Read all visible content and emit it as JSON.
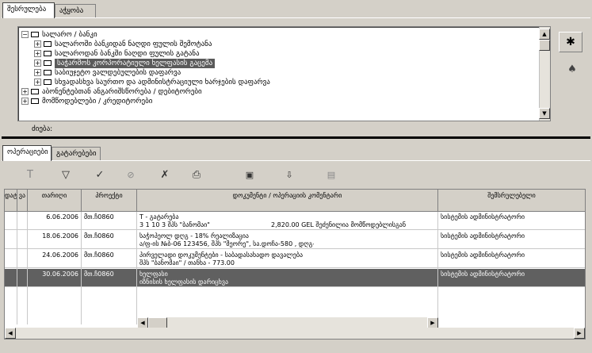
{
  "top_tabs": [
    "შესრულება",
    "აჭყობა"
  ],
  "tree": {
    "rows": [
      {
        "label": "სალარო / ბანკი",
        "level": 0,
        "expander": "−",
        "selected": false
      },
      {
        "label": "სალაროში ბანკიდან ნაღდი ფულის შემოტანა",
        "level": 1,
        "expander": "+",
        "selected": false
      },
      {
        "label": "სალაროდან ბანკში ნაღდი ფულის გატანა",
        "level": 1,
        "expander": "+",
        "selected": false
      },
      {
        "label": "საჭარმოს კორპორატიული ხელფასის გაცემა",
        "level": 1,
        "expander": "+",
        "selected": true
      },
      {
        "label": "საბიუჯეტო ვალდებულების დაფარვა",
        "level": 1,
        "expander": "+",
        "selected": false
      },
      {
        "label": "სხვადასხვა საურთო და ადმინისტრაციული ხარჯების დაფარვა",
        "level": 1,
        "expander": "+",
        "selected": false
      },
      {
        "label": "აბონენტებთან ანგარიშსწორება / დებიტორები",
        "level": 0,
        "expander": "+",
        "selected": false
      },
      {
        "label": "მომწოდებლები / კრედიტორები",
        "level": 0,
        "expander": "+",
        "selected": false
      }
    ],
    "search_label": "ძიება:"
  },
  "bottom_tabs": [
    "ოპერაციები",
    "გატარებები"
  ],
  "toolbar": {
    "icons": [
      "clear-filter-icon",
      "filter-icon",
      "approve-icon",
      "pause-icon",
      "delete-icon",
      "print-icon",
      "preview-icon",
      "export-icon",
      "copy-icon"
    ]
  },
  "grid": {
    "headers": {
      "col1": "დატა",
      "col2": "ვა",
      "date": "თარიღი",
      "project": "პროექტი",
      "desc": "დოკუმენტი / ოპერაციის კომენტარი",
      "executor": "შემსრულებელი"
    },
    "rows": [
      {
        "date": "6.06.2006",
        "project": "მთ.ჩ0860",
        "line1": "T - გატარება",
        "line2": "3 1 10 3 შპს \"ბანომაი\"",
        "amount": "2,820.00 GEL  შეძენილია მომწოდებლისგან",
        "executor": "სისტემის ადმინისტრატორი",
        "selected": false
      },
      {
        "date": "18.06.2006",
        "project": "მთ.ჩ0860",
        "line1": "საჭოპეოლ დღგ - 18% რეალიზაცია",
        "line2": "ა/ფ-ის №ბ-06 123456, შპს \"მეორე\", სა.დოჩა-580 , დღგ- 104.4",
        "amount": "",
        "executor": "სისტემის ადმინისტრატორი",
        "selected": false
      },
      {
        "date": "24.06.2006",
        "project": "მთ.ჩ0860",
        "line1": "პირველადი დოკუმენტები  - საბადასახადო დავალება",
        "line2": "შპს \"ბანომაი\" / თანხა -    773.00",
        "amount": "",
        "executor": "სისტემის ადმინისტრატორი",
        "selected": false
      },
      {
        "date": "30.06.2006",
        "project": "მთ.ჩ0860",
        "line1": "ხელფასი",
        "line2": "იზნისის ხელფასის დარიცხვა",
        "amount": "",
        "executor": "სისტემის ადმინისტრატორი",
        "selected": true
      }
    ]
  },
  "side_buttons": [
    "bug-icon",
    "mushroom-icon"
  ]
}
